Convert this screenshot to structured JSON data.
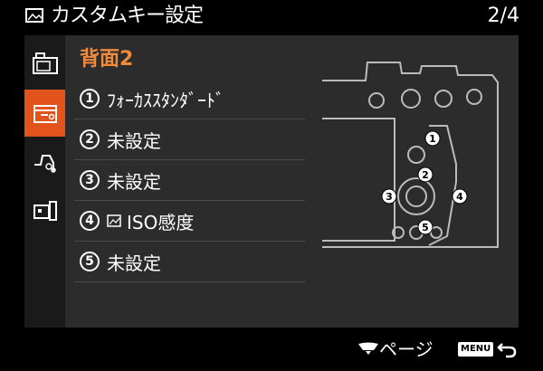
{
  "header": {
    "title": "カスタムキー設定",
    "page": "2/4",
    "title_icon": "picture-icon"
  },
  "sidebar": {
    "tabs": [
      {
        "name": "camera-icon",
        "active": false
      },
      {
        "name": "camera-custom-icon",
        "active": true
      },
      {
        "name": "hand-settings-icon",
        "active": false
      },
      {
        "name": "battery-icon",
        "active": false
      }
    ]
  },
  "main": {
    "section_title": "背面2",
    "items": [
      {
        "num": "1",
        "label": "ﾌｫｰｶｽｽﾀﾝﾀﾞｰﾄﾞ",
        "icon": ""
      },
      {
        "num": "2",
        "label": "未設定",
        "icon": ""
      },
      {
        "num": "3",
        "label": "未設定",
        "icon": ""
      },
      {
        "num": "4",
        "label": "ISO感度",
        "icon": "photo-iso-icon"
      },
      {
        "num": "5",
        "label": "未設定",
        "icon": ""
      }
    ]
  },
  "diagram": {
    "labels": [
      "1",
      "2",
      "3",
      "4",
      "5"
    ]
  },
  "footer": {
    "page_label": "ページ",
    "menu_label": "MENU",
    "back_icon": "return-arrow-icon"
  },
  "colors": {
    "accent": "#e2541c",
    "title_orange": "#f08a3c",
    "panel": "#2c2c2c"
  }
}
